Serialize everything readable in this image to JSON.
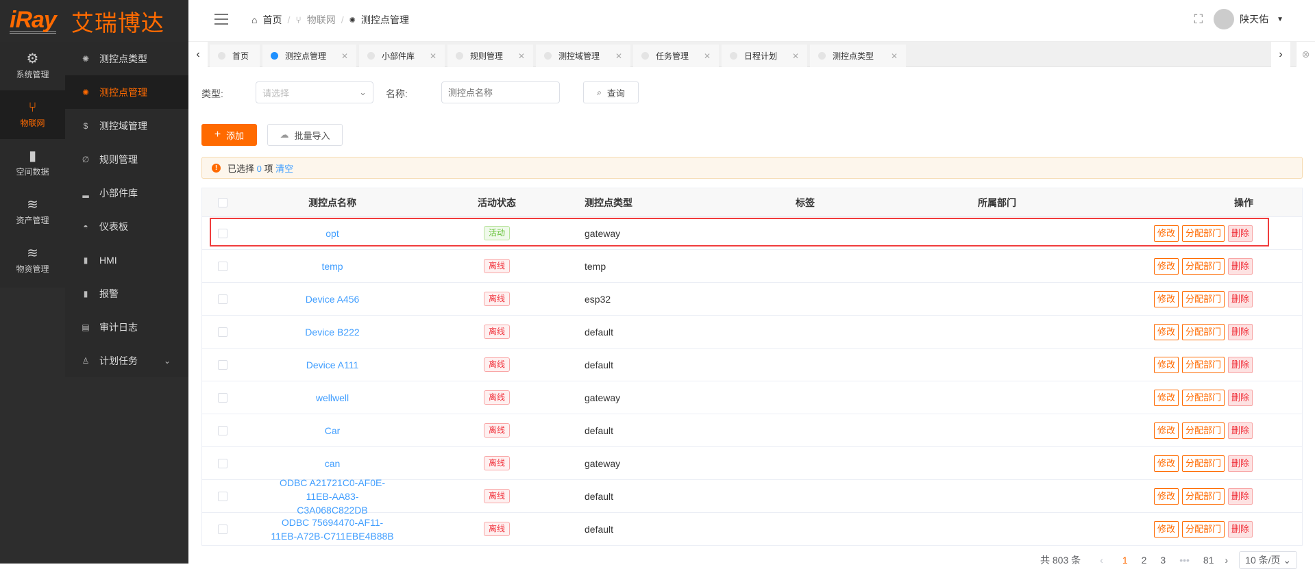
{
  "logo": {
    "en": "iRay",
    "cn": "艾瑞博达"
  },
  "icon_nav": [
    {
      "label": "系统管理",
      "icon": "gear-icon"
    },
    {
      "label": "物联网",
      "icon": "iot-fork-icon",
      "active": true
    },
    {
      "label": "空间数据",
      "icon": "map-icon"
    },
    {
      "label": "资产管理",
      "icon": "layers-icon"
    },
    {
      "label": "物资管理",
      "icon": "layers-icon"
    }
  ],
  "submenu": [
    {
      "label": "测控点类型",
      "icon": "gear-small-icon"
    },
    {
      "label": "测控点管理",
      "icon": "gear-small-icon",
      "active": true
    },
    {
      "label": "测控域管理",
      "icon": "dollar-icon"
    },
    {
      "label": "规则管理",
      "icon": "link-icon"
    },
    {
      "label": "小部件库",
      "icon": "bar-chart-icon"
    },
    {
      "label": "仪表板",
      "icon": "dashboard-icon"
    },
    {
      "label": "HMI",
      "icon": "battery-icon"
    },
    {
      "label": "报警",
      "icon": "battery-icon"
    },
    {
      "label": "审计日志",
      "icon": "clipboard-icon"
    },
    {
      "label": "计划任务",
      "icon": "person-icon",
      "expandable": true
    }
  ],
  "breadcrumb": [
    "首页",
    "物联网",
    "测控点管理"
  ],
  "user": {
    "name": "陕天佑"
  },
  "tabs": [
    {
      "label": "首页",
      "closable": false
    },
    {
      "label": "测控点管理",
      "active": true
    },
    {
      "label": "小部件库"
    },
    {
      "label": "规则管理"
    },
    {
      "label": "测控域管理"
    },
    {
      "label": "任务管理"
    },
    {
      "label": "日程计划"
    },
    {
      "label": "测控点类型"
    }
  ],
  "filters": {
    "type_label": "类型:",
    "type_placeholder": "请选择",
    "name_label": "名称:",
    "name_placeholder": "测控点名称",
    "search_label": "查询"
  },
  "toolbar": {
    "add_label": "添加",
    "import_label": "批量导入"
  },
  "alert": {
    "prefix": "已选择",
    "count": "0",
    "suffix": "项",
    "clear": "清空"
  },
  "table": {
    "columns": [
      "测控点名称",
      "活动状态",
      "测控点类型",
      "标签",
      "所属部门",
      "操作"
    ],
    "actions": {
      "edit": "修改",
      "assign": "分配部门",
      "delete": "删除"
    },
    "rows": [
      {
        "name": "opt",
        "status": "活动",
        "active": true,
        "type": "gateway",
        "tag": "",
        "dept": ""
      },
      {
        "name": "temp",
        "status": "离线",
        "active": false,
        "type": "temp",
        "tag": "",
        "dept": ""
      },
      {
        "name": "Device A456",
        "status": "离线",
        "active": false,
        "type": "esp32",
        "tag": "",
        "dept": ""
      },
      {
        "name": "Device B222",
        "status": "离线",
        "active": false,
        "type": "default",
        "tag": "",
        "dept": ""
      },
      {
        "name": "Device A111",
        "status": "离线",
        "active": false,
        "type": "default",
        "tag": "",
        "dept": ""
      },
      {
        "name": "wellwell",
        "status": "离线",
        "active": false,
        "type": "gateway",
        "tag": "",
        "dept": ""
      },
      {
        "name": "Car",
        "status": "离线",
        "active": false,
        "type": "default",
        "tag": "",
        "dept": ""
      },
      {
        "name": "can",
        "status": "离线",
        "active": false,
        "type": "gateway",
        "tag": "",
        "dept": ""
      },
      {
        "name": "ODBC A21721C0-AF0E-11EB-AA83-C3A068C822DB",
        "status": "离线",
        "active": false,
        "type": "default",
        "tag": "",
        "dept": ""
      },
      {
        "name": "ODBC 75694470-AF11-11EB-A72B-C711EBE4B88B",
        "status": "离线",
        "active": false,
        "type": "default",
        "tag": "",
        "dept": ""
      }
    ]
  },
  "pagination": {
    "total": "共 803 条",
    "pages": [
      "1",
      "2",
      "3",
      "•••",
      "81"
    ],
    "current": "1",
    "page_size": "10 条/页"
  },
  "colors": {
    "accent": "#ff6a00",
    "link": "#409eff",
    "highlight": "#f03c3c"
  }
}
